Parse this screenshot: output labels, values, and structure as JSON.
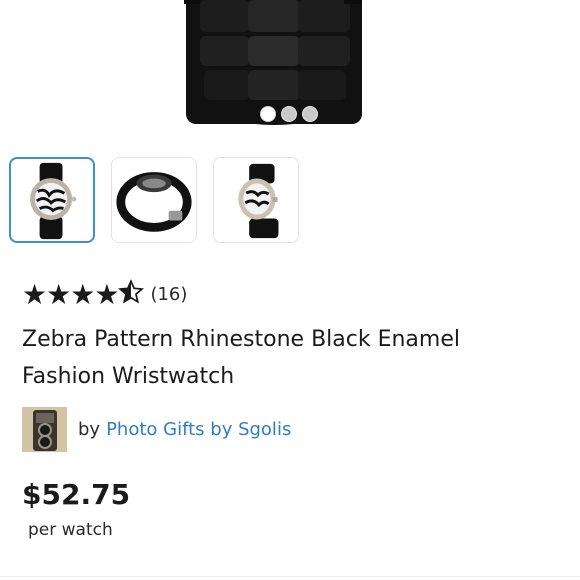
{
  "product": {
    "title": "Zebra Pattern Rhinestone Black Enamel Fashion Wristwatch",
    "rating_stars": 4.5,
    "rating_count": "(16)",
    "price": "$52.75",
    "unit": "per watch"
  },
  "gallery": {
    "image_count": 3,
    "active_index": 0,
    "thumbnails": [
      "watch-front-thumb",
      "watch-back-thumb",
      "watch-angle-thumb"
    ]
  },
  "seller": {
    "prefix": "by",
    "name": "Photo Gifts by Sgolis",
    "avatar_icon": "vintage-camera-icon"
  },
  "colors": {
    "link": "#2f7dc4",
    "thumb_selected_border": "#3e8ed0",
    "text": "#1b1b1b"
  }
}
